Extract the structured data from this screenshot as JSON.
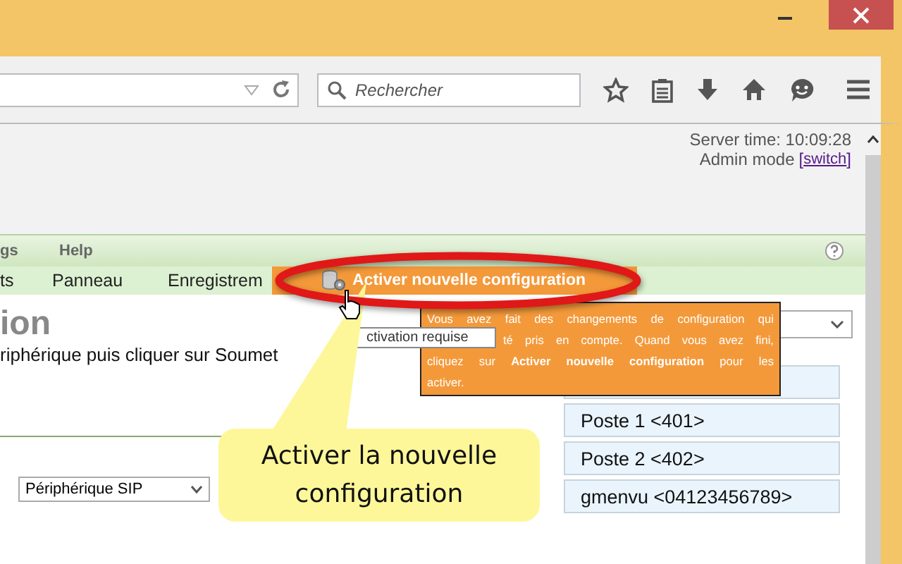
{
  "toolbar": {
    "search": {
      "placeholder": "Rechercher"
    }
  },
  "header": {
    "server_time": "Server time: 10:09:28",
    "admin_mode": "Admin mode",
    "link_open": "[",
    "switch_link": "switch",
    "link_close": "]"
  },
  "menu": [
    {
      "label": "gs"
    },
    {
      "label": "Help"
    }
  ],
  "nav": [
    {
      "label": "ts",
      "kind": "link"
    },
    {
      "label": "Panneau",
      "kind": "link"
    },
    {
      "label": "Enregistrem",
      "kind": "link"
    },
    {
      "label": "Activer nouvelle configuration",
      "kind": "action"
    }
  ],
  "page": {
    "heading": "ion",
    "instruction": "riphérique puis cliquer sur Soumet",
    "device_type": "Périphérique SIP",
    "field_hint": "ctivation requise"
  },
  "extensions": [
    "Poste 1 <401>",
    "Poste 2 <402>",
    "gmenvu <04123456789>"
  ],
  "tooltip": {
    "lines": [
      "Vous avez fait des changements de configuration qui",
      "té pris en compte. Quand vous avez fini,",
      "cliquez sur **Activer nouvelle configuration** pour les",
      "activer."
    ]
  },
  "callout": {
    "text": "Activer la nouvelle configuration"
  }
}
